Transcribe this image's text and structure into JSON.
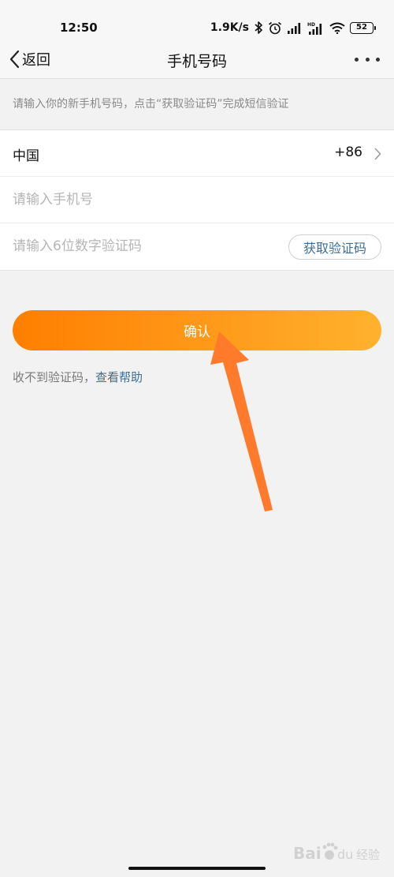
{
  "status_bar": {
    "time": "12:50",
    "net_speed": "1.9K/s",
    "icons": [
      "bluetooth-icon",
      "alarm-icon",
      "signal-icon",
      "hd-signal-icon",
      "wifi-icon",
      "battery-icon"
    ],
    "hd_label": "HD",
    "battery": "52"
  },
  "nav": {
    "back_label": "返回",
    "title": "手机号码",
    "more_icon": "more-dots-icon"
  },
  "hint": "请输入你的新手机号码，点击“获取验证码”完成短信验证",
  "form": {
    "country_label": "中国",
    "country_code": "+86",
    "phone_placeholder": "请输入手机号",
    "phone_value": "",
    "code_placeholder": "请输入6位数字验证码",
    "code_value": "",
    "get_code_label": "获取验证码"
  },
  "confirm_label": "确认",
  "help": {
    "prefix": "收不到验证码，",
    "link": "查看帮助"
  },
  "watermark": {
    "brand": "Bai",
    "brand_suffix": "du",
    "sub": "经验"
  },
  "colors": {
    "accent_orange": "#ff8a00",
    "link_blue": "#3d6d94",
    "arrow": "#ff7a2b"
  }
}
